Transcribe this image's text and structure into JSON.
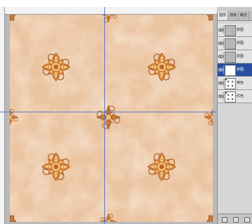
{
  "window": {
    "title": ""
  },
  "colors": {
    "tile_base": "#ebc4a1",
    "medallion_outer": "#d99149",
    "medallion_inner": "#f6cb88",
    "medallion_center": "#b86327",
    "guide": "#3e6fd1",
    "selected_layer": "#2b4f9e"
  },
  "layers_panel": {
    "tabs": [
      {
        "label": "图层"
      },
      {
        "label": "通道"
      },
      {
        "label": "路径"
      }
    ],
    "layers": [
      {
        "name": "拼图",
        "thumb": "grainy",
        "selected": false
      },
      {
        "name": "拼图",
        "thumb": "grainy",
        "selected": false
      },
      {
        "name": "拼图",
        "thumb": "grainy",
        "selected": false
      },
      {
        "name": "拼图",
        "thumb": "plain",
        "selected": true
      },
      {
        "name": "黄色",
        "thumb": "dots",
        "selected": false
      },
      {
        "name": "红色",
        "thumb": "dots",
        "selected": false
      }
    ]
  }
}
